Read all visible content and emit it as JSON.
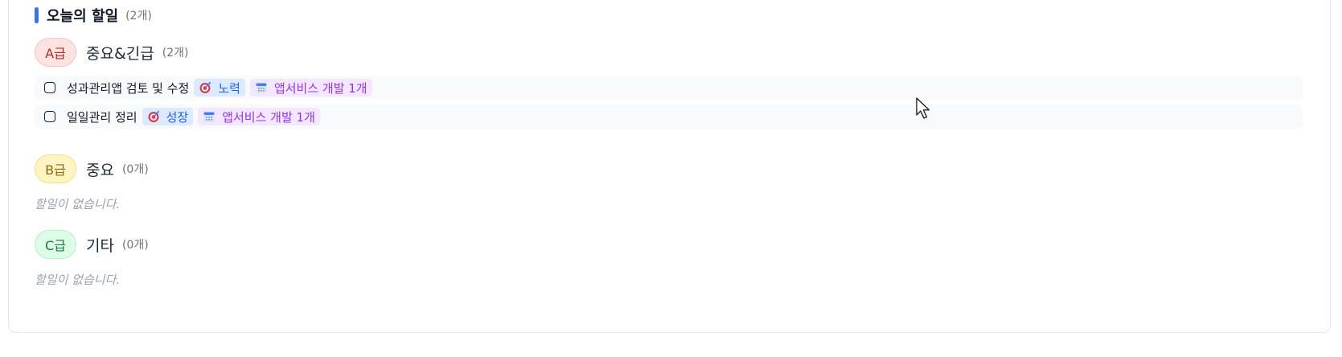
{
  "section": {
    "title": "오늘의 할일",
    "count": "(2개)"
  },
  "groups": [
    {
      "grade": "A급",
      "title": "중요&긴급",
      "count": "(2개)",
      "tasks": [
        {
          "title": "성과관리앱 검토 및 수정",
          "goal_tag": "노력",
          "project_tag": "앱서비스 개발 1개"
        },
        {
          "title": "일일관리 정리",
          "goal_tag": "성장",
          "project_tag": "앱서비스 개발 1개"
        }
      ]
    },
    {
      "grade": "B급",
      "title": "중요",
      "count": "(0개)",
      "empty_text": "할일이 없습니다."
    },
    {
      "grade": "C급",
      "title": "기타",
      "count": "(0개)",
      "empty_text": "할일이 없습니다."
    }
  ],
  "icons": {
    "goal": "target-icon",
    "project": "calendar-icon",
    "cursor": "mouse-cursor-icon"
  },
  "colors": {
    "accent": "#3b6ff5",
    "goal_tag_bg": "#dbeafe",
    "goal_tag_text": "#2563eb",
    "project_tag_bg": "#f3e8ff",
    "project_tag_text": "#9333ea"
  }
}
